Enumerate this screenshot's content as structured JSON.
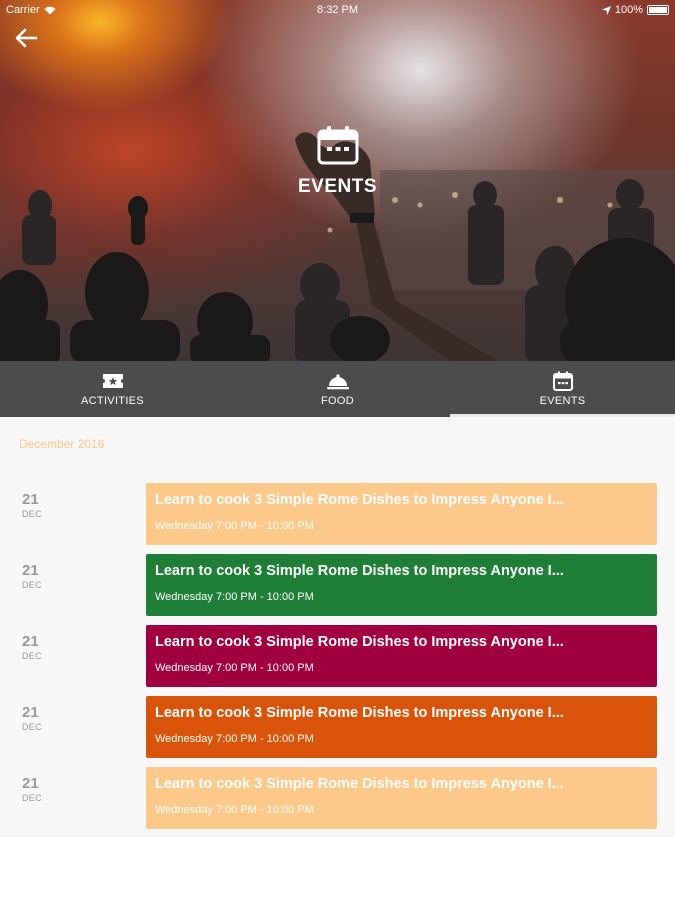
{
  "status_bar": {
    "carrier": "Carrier",
    "time": "8:32 PM",
    "battery": "100%"
  },
  "hero": {
    "title": "EVENTS",
    "icon": "calendar-icon"
  },
  "tabs": [
    {
      "label": "ACTIVITIES",
      "icon": "ticket-star-icon",
      "active": false
    },
    {
      "label": "FOOD",
      "icon": "cloche-icon",
      "active": false
    },
    {
      "label": "EVENTS",
      "icon": "calendar-icon",
      "active": true
    }
  ],
  "list": {
    "month": "December 2016",
    "events": [
      {
        "day": "21",
        "month": "DEC",
        "title": "Learn to cook 3 Simple Rome Dishes to Impress Anyone I...",
        "time": "Wednesday 7:00 PM - 10:00 PM",
        "color": "#fcc98b"
      },
      {
        "day": "21",
        "month": "DEC",
        "title": "Learn to cook 3 Simple Rome Dishes to Impress Anyone I...",
        "time": "Wednesday 7:00 PM - 10:00 PM",
        "color": "#1f7f37"
      },
      {
        "day": "21",
        "month": "DEC",
        "title": "Learn to cook 3 Simple Rome Dishes to Impress Anyone I...",
        "time": "Wednesday 7:00 PM - 10:00 PM",
        "color": "#a0003e"
      },
      {
        "day": "21",
        "month": "DEC",
        "title": "Learn to cook 3 Simple Rome Dishes to Impress Anyone I...",
        "time": "Wednesday 7:00 PM - 10:00 PM",
        "color": "#d9540a"
      },
      {
        "day": "21",
        "month": "DEC",
        "title": "Learn to cook 3 Simple Rome Dishes to Impress Anyone I...",
        "time": "Wednesday 7:00 PM - 10:00 PM",
        "color": "#fcc98b"
      }
    ]
  }
}
